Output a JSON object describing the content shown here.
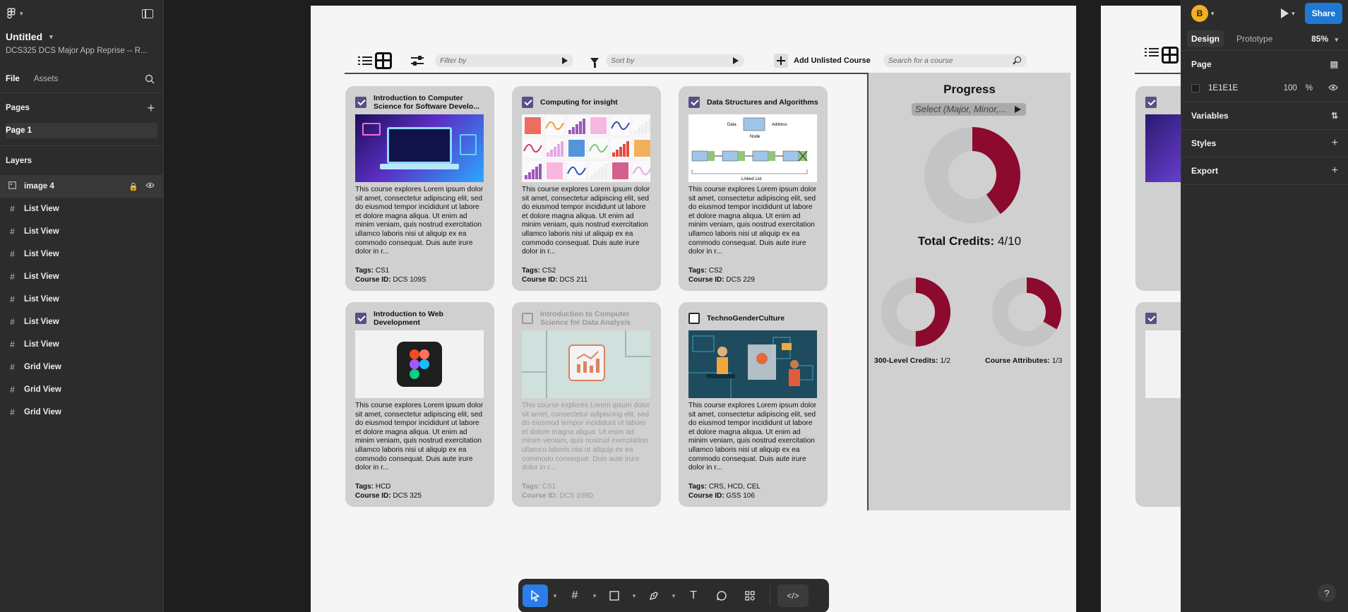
{
  "left_panel": {
    "file_title": "Untitled",
    "file_subtitle": "DCS325 DCS Major App Reprise -- R...",
    "tabs": [
      "File",
      "Assets"
    ],
    "pages_label": "Pages",
    "pages": [
      "Page 1"
    ],
    "layers_label": "Layers",
    "layers": [
      {
        "icon": "image-icon",
        "name": "image 4",
        "selected": true
      },
      {
        "icon": "frame-icon",
        "name": "List View"
      },
      {
        "icon": "frame-icon",
        "name": "List View"
      },
      {
        "icon": "frame-icon",
        "name": "List View"
      },
      {
        "icon": "frame-icon",
        "name": "List View"
      },
      {
        "icon": "frame-icon",
        "name": "List View"
      },
      {
        "icon": "frame-icon",
        "name": "List View"
      },
      {
        "icon": "frame-icon",
        "name": "List View"
      },
      {
        "icon": "frame-icon",
        "name": "Grid View"
      },
      {
        "icon": "frame-icon",
        "name": "Grid View"
      },
      {
        "icon": "frame-icon",
        "name": "Grid View"
      }
    ]
  },
  "toolbar": {
    "filter_placeholder": "Filter by",
    "sort_placeholder": "Sort by",
    "add_label": "Add Unlisted Course",
    "search_placeholder": "Search for a course"
  },
  "courses": [
    {
      "title": "Introduction to Computer Science for Software Develo...",
      "checked": true,
      "faded": false,
      "image": "laptop-illustration",
      "desc": "This course explores Lorem ipsum dolor sit amet, consectetur adipiscing elit, sed do eiusmod tempor incididunt ut labore et dolore magna aliqua. Ut enim ad minim veniam, quis nostrud exercitation ullamco laboris nisi ut aliquip ex ea commodo consequat. Duis aute irure dolor in r...",
      "tags_label": "Tags:",
      "tags": "CS1",
      "id_label": "Course ID:",
      "course_id": "DCS 109S"
    },
    {
      "title": "Computing for insight",
      "checked": true,
      "faded": false,
      "image": "chart-grid",
      "desc": "This course explores Lorem ipsum dolor sit amet, consectetur adipiscing elit, sed do eiusmod tempor incididunt ut labore et dolore magna aliqua. Ut enim ad minim veniam, quis nostrud exercitation ullamco laboris nisi ut aliquip ex ea commodo consequat. Duis aute irure dolor in r...",
      "tags_label": "Tags:",
      "tags": "CS2",
      "id_label": "Course ID:",
      "course_id": "DCS 211"
    },
    {
      "title": "Data Structures and Algorithms",
      "checked": true,
      "faded": false,
      "image": "linked-list-diagram",
      "desc": "This course explores Lorem ipsum dolor sit amet, consectetur adipiscing elit, sed do eiusmod tempor incididunt ut labore et dolore magna aliqua. Ut enim ad minim veniam, quis nostrud exercitation ullamco laboris nisi ut aliquip ex ea commodo consequat. Duis aute irure dolor in r...",
      "tags_label": "Tags:",
      "tags": "CS2",
      "id_label": "Course ID:",
      "course_id": "DCS 229"
    },
    {
      "title": "Introduction to Web Development",
      "checked": true,
      "faded": false,
      "image": "figma-logo",
      "desc": "This course explores Lorem ipsum dolor sit amet, consectetur adipiscing elit, sed do eiusmod tempor incididunt ut labore et dolore magna aliqua. Ut enim ad minim veniam, quis nostrud exercitation ullamco laboris nisi ut aliquip ex ea commodo consequat. Duis aute irure dolor in r...",
      "tags_label": "Tags:",
      "tags": "HCD",
      "id_label": "Course ID:",
      "course_id": "DCS 325"
    },
    {
      "title": "Introduction to Computer Science for Data Analysis",
      "checked": false,
      "faded": true,
      "image": "analytics-icon",
      "desc": "This course explores Lorem ipsum dolor sit amet, consectetur adipiscing elit, sed do eiusmod tempor incididunt ut labore et dolore magna aliqua. Ut enim ad minim veniam, quis nostrud exercitation ullamco laboris nisi ut aliquip ex ea commodo consequat. Duis aute irure dolor in r...",
      "tags_label": "Tags:",
      "tags": "CS1",
      "id_label": "Course ID:",
      "course_id": "DCS 109D"
    },
    {
      "title": "TechnoGenderCulture",
      "checked": false,
      "faded": false,
      "image": "tech-people-illustration",
      "desc": "This course explores Lorem ipsum dolor sit amet, consectetur adipiscing elit, sed do eiusmod tempor incididunt ut labore et dolore magna aliqua. Ut enim ad minim veniam, quis nostrud exercitation ullamco laboris nisi ut aliquip ex ea commodo consequat. Duis aute irure dolor in r...",
      "tags_label": "Tags:",
      "tags": "CRS, HCD, CEL",
      "id_label": "Course ID:",
      "course_id": "GSS 106"
    }
  ],
  "progress": {
    "title": "Progress",
    "select_placeholder": "Select (Major, Minor,...",
    "total_label": "Total Credits:",
    "total_value": "4/10",
    "total_fraction": 0.4,
    "level300_label": "300-Level Credits:",
    "level300_value": "1/2",
    "level300_fraction": 0.5,
    "attributes_label": "Course Attributes:",
    "attributes_value": "1/3",
    "attributes_fraction": 0.333,
    "fill_color": "#8b0a2e",
    "track_color": "#c4c4c4"
  },
  "right_panel": {
    "avatar_letter": "B",
    "share_label": "Share",
    "tabs": [
      "Design",
      "Prototype"
    ],
    "zoom": "85%",
    "page_label": "Page",
    "page_color": "1E1E1E",
    "page_opacity": "100",
    "percent_sign": "%",
    "variables_label": "Variables",
    "styles_label": "Styles",
    "export_label": "Export",
    "help": "?"
  }
}
